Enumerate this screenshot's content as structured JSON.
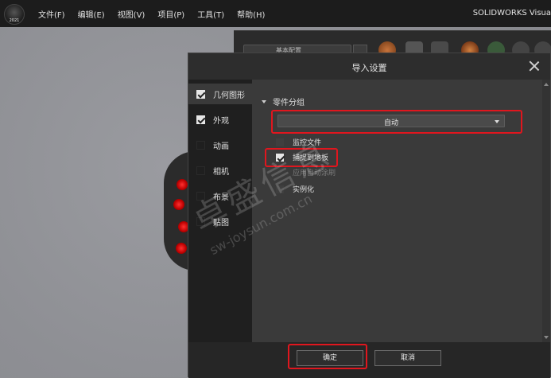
{
  "app": {
    "version_badge": "2021",
    "title": "SOLIDWORKS Visua"
  },
  "menu": {
    "items": [
      "文件(F)",
      "编辑(E)",
      "视图(V)",
      "项目(P)",
      "工具(T)",
      "帮助(H)"
    ]
  },
  "toolbar": {
    "dropdown_value": "基本配置"
  },
  "dialog": {
    "title": "导入设置",
    "nav": [
      {
        "label": "几何图形",
        "checked": true
      },
      {
        "label": "外观",
        "checked": true
      },
      {
        "label": "动画",
        "checked": false
      },
      {
        "label": "相机",
        "checked": false
      },
      {
        "label": "布景",
        "checked": false
      },
      {
        "label": "贴图",
        "checked": false
      }
    ],
    "section_title": "零件分组",
    "group_dropdown_value": "自动",
    "options": {
      "monitor_file": "监控文件",
      "snap_to_floor": "捕捉到地板",
      "apply_auto_paint": "应用自动涂刷",
      "instance": "实例化"
    },
    "ok_label": "确定",
    "cancel_label": "取消"
  },
  "watermark": {
    "line1": "卓盛信息",
    "line2": "sw-joysun.com.cn"
  },
  "colors": {
    "highlight": "#e0161e",
    "dialog_bg": "#2d2d2d",
    "menubar_bg": "#1c1c1c"
  }
}
